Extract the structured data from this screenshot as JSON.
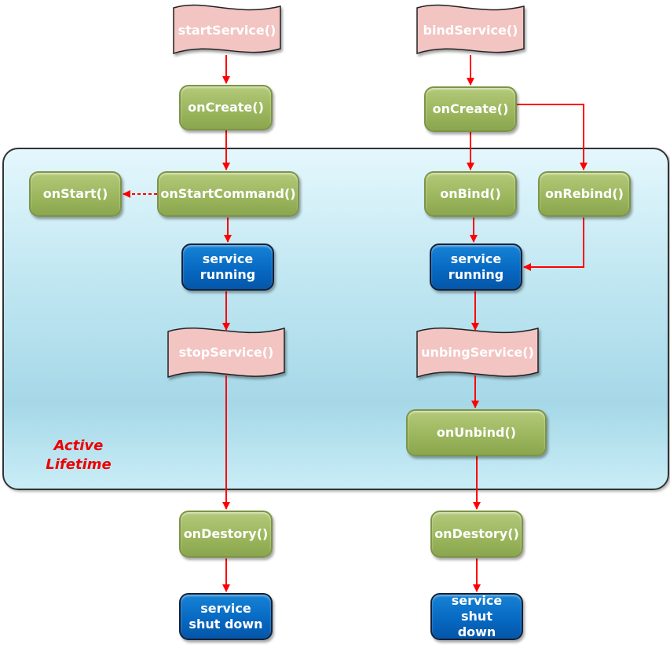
{
  "colors": {
    "arrow": "#ff0000",
    "method_box": "#9ab55c",
    "state_box": "#0667c0",
    "call_banner": "#f2c4c2",
    "active_region": "#bfe6f1",
    "active_label": "#ee0000"
  },
  "left_flow": {
    "call": "startService()",
    "on_create": "onCreate()",
    "on_start_command": "onStartCommand()",
    "on_start": "onStart()",
    "running": "service running",
    "stop": "stopService()",
    "on_destroy": "onDestory()",
    "shutdown": "service shut down"
  },
  "right_flow": {
    "call": "bindService()",
    "on_create": "onCreate()",
    "on_bind": "onBind()",
    "on_rebind": "onRebind()",
    "running": "service running",
    "unbind": "unbingService()",
    "on_unbind": "onUnbind()",
    "on_destroy": "onDestory()",
    "shutdown": "service shut down"
  },
  "active_lifetime_label": "Active Lifetime"
}
